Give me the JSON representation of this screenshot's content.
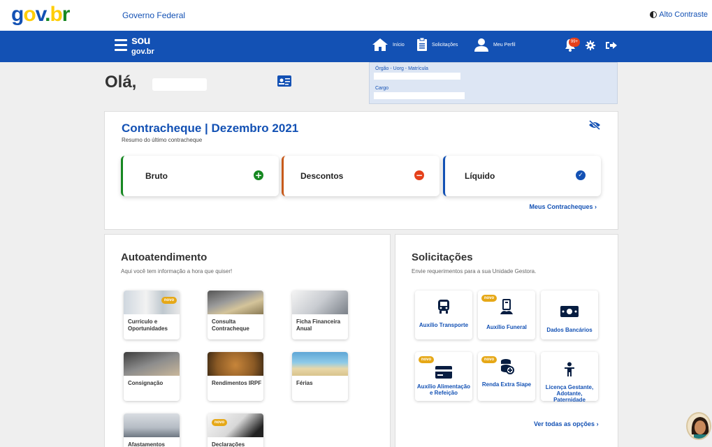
{
  "header": {
    "logo_text": "gov.br",
    "gov_federal": "Governo Federal",
    "alto_contraste": "Alto Contraste"
  },
  "navbar": {
    "logo_top": "sou",
    "logo_bottom": "gov.br",
    "items": [
      {
        "label": "Início",
        "icon": "home-icon"
      },
      {
        "label": "Solicitações",
        "icon": "clipboard-icon"
      },
      {
        "label": "Meu Perfil",
        "icon": "user-icon"
      }
    ],
    "notification_badge": "99+"
  },
  "greeting": {
    "hello": "Olá,"
  },
  "org_box": {
    "orgao_label": "Órgão - Uorg - Matrícula",
    "cargo_label": "Cargo"
  },
  "contracheque": {
    "title": "Contracheque | Dezembro 2021",
    "subtitle": "Resumo do último contracheque",
    "boxes": [
      {
        "label": "Bruto",
        "icon": "plus-circle-icon",
        "color": "#168821"
      },
      {
        "label": "Descontos",
        "icon": "minus-circle-icon",
        "color": "#e5401a"
      },
      {
        "label": "Líquido",
        "icon": "check-circle-icon",
        "color": "#1351b4"
      }
    ],
    "link": "Meus Contracheques"
  },
  "autoatendimento": {
    "title": "Autoatendimento",
    "subtitle": "Aqui você tem informação a hora que quiser!",
    "tiles": [
      {
        "label": "Currículo e Oportunidades",
        "novo": true
      },
      {
        "label": "Consulta Contracheque",
        "novo": false
      },
      {
        "label": "Ficha Financeira Anual",
        "novo": false
      },
      {
        "label": "Consignação",
        "novo": false
      },
      {
        "label": "Rendimentos IRPF",
        "novo": false
      },
      {
        "label": "Férias",
        "novo": false
      },
      {
        "label": "Afastamentos",
        "novo": false
      },
      {
        "label": "Declarações",
        "novo": true
      }
    ]
  },
  "solicitacoes": {
    "title": "Solicitações",
    "subtitle": "Envie requerimentos para a sua Unidade Gestora.",
    "tiles": [
      {
        "label": "Auxílio Transporte",
        "icon": "bus-icon",
        "novo": false
      },
      {
        "label": "Auxílio Funeral",
        "icon": "funeral-icon",
        "novo": true
      },
      {
        "label": "Dados Bancários",
        "icon": "money-icon",
        "novo": false
      },
      {
        "label": "Auxílio Alimentação e Refeição",
        "icon": "card-icon",
        "novo": true
      },
      {
        "label": "Renda Extra Siape",
        "icon": "coins-icon",
        "novo": true
      },
      {
        "label": "Licença Gestante, Adotante, Paternidade",
        "icon": "child-icon",
        "novo": false
      }
    ],
    "link": "Ver todas as opções"
  },
  "novo_label": "novo",
  "colors": {
    "primary": "#1351b4",
    "nav": "#1351b4",
    "novo": "#e6a817",
    "bg": "#efefef"
  }
}
